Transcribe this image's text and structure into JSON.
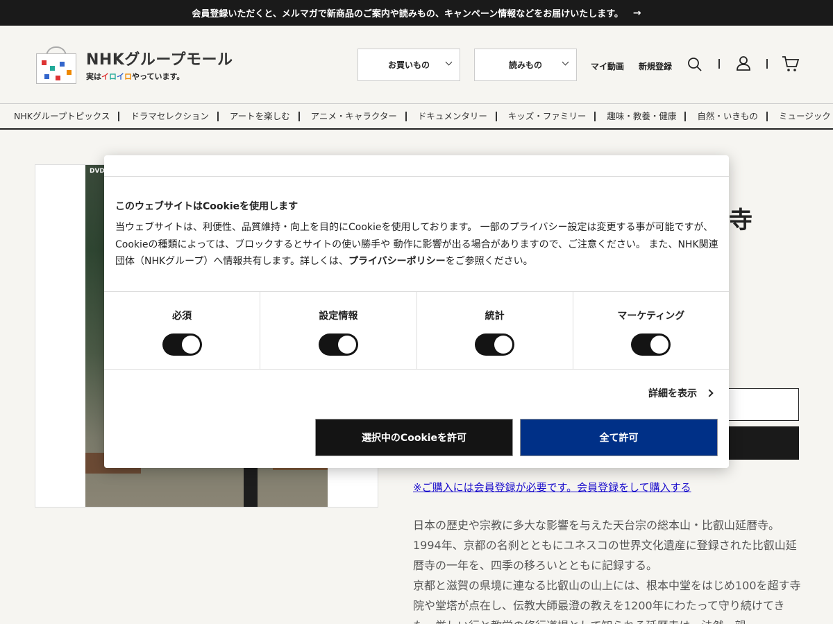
{
  "announcement": {
    "text": "会員登録いただくと、メルマガで新商品のご案内や読みもの、キャンペーン情報などをお届けいたします。"
  },
  "header": {
    "logo_main": "NHKグループモール",
    "logo_sub_parts": [
      "実は",
      "イ",
      "ロ",
      "イ",
      "ロ",
      "やっています。"
    ],
    "shopping_select": "お買いもの",
    "reading_select": "読みもの",
    "my_video": "マイ動画",
    "register": "新規登録"
  },
  "categories": [
    "NHKグループトピックス",
    "ドラマセレクション",
    "アートを楽しむ",
    "アニメ・キャラクター",
    "ドキュメンタリー",
    "キッズ・ファミリー",
    "趣味・教養・健康",
    "自然・いきもの",
    "ミュージック"
  ],
  "product": {
    "title_fragment": "寺",
    "image_badge": "DVD",
    "member_notice": "※ご購入には会員登録が必要です。会員登録をして購入する",
    "description": [
      "日本の歴史や宗教に多大な影響を与えた天台宗の総本山・比叡山延暦寺。1994年、京都の名刹とともにユネスコの世界文化遺産に登録された比叡山延暦寺の一年を、四季の移ろいとともに記録する。",
      "京都と滋賀の県境に連なる比叡山の山上には、根本中堂をはじめ100を超す寺院や堂塔が点在し、伝教大師最澄の教えを1200年にわたって守り続けてきた。厳しい行と教学の修行道場として知られる延暦寺は、法然、親"
    ]
  },
  "cookie": {
    "heading": "このウェブサイトはCookieを使用します",
    "body_before": "当ウェブサイトは、利便性、品質維持・向上を目的にCookieを使用しております。 一部のプライバシー設定は変更する事が可能ですが、 Cookieの種類によっては、ブロックするとサイトの使い勝手や 動作に影響が出る場合がありますので、ご注意ください。 また、NHK関連団体（NHKグループ）へ情報共有します。詳しくは、",
    "policy_link": "プライバシーポリシー",
    "body_after": "をご参照ください。",
    "categories": [
      {
        "label": "必須",
        "enabled": true
      },
      {
        "label": "設定情報",
        "enabled": true
      },
      {
        "label": "統計",
        "enabled": true
      },
      {
        "label": "マーケティング",
        "enabled": true
      }
    ],
    "details_label": "詳細を表示",
    "allow_selected": "選択中のCookieを許可",
    "allow_all": "全て許可"
  },
  "colors": {
    "accent_blue": "#003087",
    "link": "#1a0dcc",
    "dark": "#141414"
  }
}
